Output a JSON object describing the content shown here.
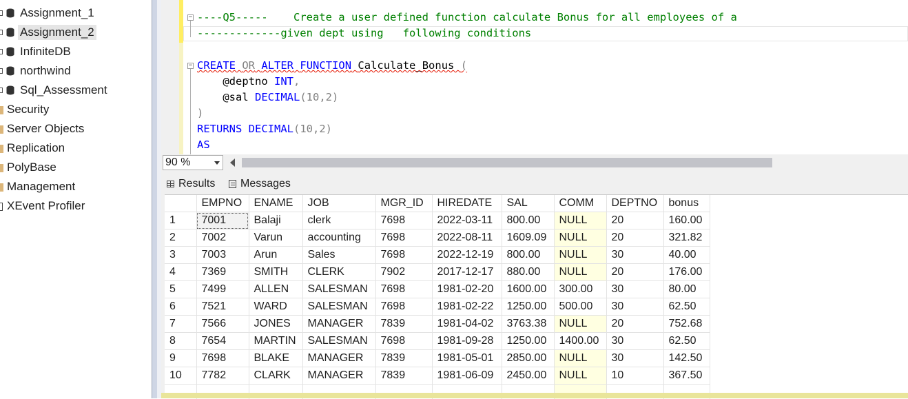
{
  "explorer": {
    "items": [
      {
        "label": "Assignment_1",
        "type": "database"
      },
      {
        "label": "Assignment_2",
        "type": "database",
        "selected": true
      },
      {
        "label": "InfiniteDB",
        "type": "database"
      },
      {
        "label": "northwind",
        "type": "database"
      },
      {
        "label": "Sql_Assessment",
        "type": "database"
      },
      {
        "label": "Security",
        "type": "folder"
      },
      {
        "label": "Server Objects",
        "type": "folder"
      },
      {
        "label": "Replication",
        "type": "folder"
      },
      {
        "label": "PolyBase",
        "type": "folder"
      },
      {
        "label": "Management",
        "type": "folder"
      },
      {
        "label": "XEvent Profiler",
        "type": "xevent"
      }
    ]
  },
  "editor": {
    "lines": {
      "l1": "----Q5-----    Create a user defined function calculate Bonus for all employees of a",
      "l2": "-------------given dept using   following conditions",
      "l3_kw1": "CREATE",
      "l3_kw2": "OR",
      "l3_kw3": "ALTER",
      "l3_kw4": "FUNCTION",
      "l3_name": "Calculate_Bonus",
      "l3_paren": "(",
      "l4_param": "@deptno",
      "l4_type": "INT",
      "l4_comma": ",",
      "l5_param": "@sal",
      "l5_type": "DECIMAL",
      "l5_args": "(10,2)",
      "l6": ")",
      "l7_kw": "RETURNS",
      "l7_type": "DECIMAL",
      "l7_args": "(10,2)",
      "l8": "AS"
    }
  },
  "zoom": {
    "value": "90 %"
  },
  "tabs": {
    "results": "Results",
    "messages": "Messages"
  },
  "grid": {
    "columns": [
      "EMPNO",
      "ENAME",
      "JOB",
      "MGR_ID",
      "HIREDATE",
      "SAL",
      "COMM",
      "DEPTNO",
      "bonus"
    ],
    "rows": [
      [
        "1",
        "7001",
        "Balaji",
        "clerk",
        "7698",
        "2022-03-11",
        "800.00",
        "NULL",
        "20",
        "160.00"
      ],
      [
        "2",
        "7002",
        "Varun",
        "accounting",
        "7698",
        "2022-08-11",
        "1609.09",
        "NULL",
        "20",
        "321.82"
      ],
      [
        "3",
        "7003",
        "Arun",
        "Sales",
        "7698",
        "2022-12-19",
        "800.00",
        "NULL",
        "30",
        "40.00"
      ],
      [
        "4",
        "7369",
        "SMITH",
        "CLERK",
        "7902",
        "2017-12-17",
        "880.00",
        "NULL",
        "20",
        "176.00"
      ],
      [
        "5",
        "7499",
        "ALLEN",
        "SALESMAN",
        "7698",
        "1981-02-20",
        "1600.00",
        "300.00",
        "30",
        "80.00"
      ],
      [
        "6",
        "7521",
        "WARD",
        "SALESMAN",
        "7698",
        "1981-02-22",
        "1250.00",
        "500.00",
        "30",
        "62.50"
      ],
      [
        "7",
        "7566",
        "JONES",
        "MANAGER",
        "7839",
        "1981-04-02",
        "3763.38",
        "NULL",
        "20",
        "752.68"
      ],
      [
        "8",
        "7654",
        "MARTIN",
        "SALESMAN",
        "7698",
        "1981-09-28",
        "1250.00",
        "1400.00",
        "30",
        "62.50"
      ],
      [
        "9",
        "7698",
        "BLAKE",
        "MANAGER",
        "7839",
        "1981-05-01",
        "2850.00",
        "NULL",
        "30",
        "142.50"
      ],
      [
        "10",
        "7782",
        "CLARK",
        "MANAGER",
        "7839",
        "1981-06-09",
        "2450.00",
        "NULL",
        "10",
        "367.50"
      ]
    ]
  },
  "colors": {
    "keyword": "#0000ff",
    "comment": "#008000",
    "null_cell": "#ffffe1",
    "change_bar": "#ffee62"
  }
}
